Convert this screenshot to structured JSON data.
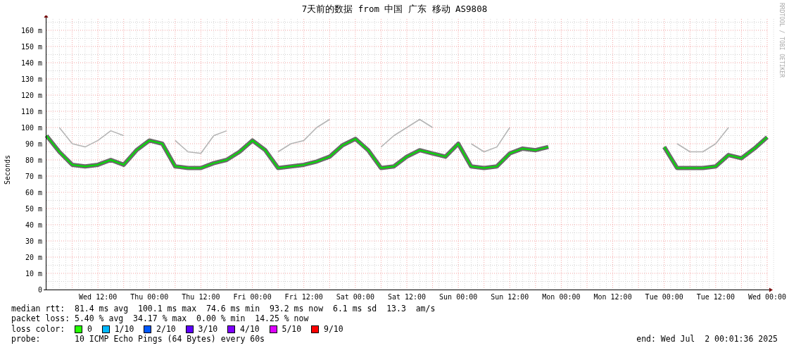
{
  "title": "7天前的数据 from 中国 广东 移动 AS9808",
  "credit": "RRDTOOL / TOBI OETIKER",
  "chart": {
    "chart_data": {
      "type": "line",
      "grid": true,
      "ylabel": "Seconds",
      "ylim": [
        0,
        167
      ],
      "categories": [
        null,
        null,
        null,
        null,
        "Wed 12:00",
        null,
        null,
        null,
        "Thu 00:00",
        null,
        null,
        null,
        "Thu 12:00",
        null,
        null,
        null,
        "Fri 00:00",
        null,
        null,
        null,
        "Fri 12:00",
        null,
        null,
        null,
        "Sat 00:00",
        null,
        null,
        null,
        "Sat 12:00",
        null,
        null,
        null,
        "Sun 00:00",
        null,
        null,
        null,
        "Sun 12:00",
        null,
        null,
        null,
        "Mon 00:00",
        null,
        null,
        null,
        "Mon 12:00",
        null,
        null,
        null,
        "Tue 00:00",
        null,
        null,
        null,
        "Tue 12:00",
        null,
        null,
        null,
        "Wed 00:00"
      ],
      "yticks": [
        {
          "value": 0,
          "label": "0"
        },
        {
          "value": 10,
          "label": "10 m"
        },
        {
          "value": 20,
          "label": "20 m"
        },
        {
          "value": 30,
          "label": "30 m"
        },
        {
          "value": 40,
          "label": "40 m"
        },
        {
          "value": 50,
          "label": "50 m"
        },
        {
          "value": 60,
          "label": "60 m"
        },
        {
          "value": 70,
          "label": "70 m"
        },
        {
          "value": 80,
          "label": "80 m"
        },
        {
          "value": 90,
          "label": "90 m"
        },
        {
          "value": 100,
          "label": "100 m"
        },
        {
          "value": 110,
          "label": "110 m"
        },
        {
          "value": 120,
          "label": "120 m"
        },
        {
          "value": 130,
          "label": "130 m"
        },
        {
          "value": 140,
          "label": "140 m"
        },
        {
          "value": 150,
          "label": "150 m"
        },
        {
          "value": 160,
          "label": "160 m"
        }
      ],
      "series": [
        {
          "color": "#b4b4b4",
          "values": [
            null,
            100,
            90,
            88,
            92,
            98,
            95,
            null,
            null,
            null,
            92,
            85,
            84,
            95,
            98,
            null,
            null,
            null,
            85,
            90,
            92,
            100,
            105,
            null,
            null,
            null,
            88,
            95,
            100,
            105,
            100,
            null,
            null,
            90,
            85,
            88,
            100,
            null,
            null,
            null,
            null,
            null,
            null,
            null,
            null,
            null,
            null,
            null,
            null,
            90,
            85,
            85,
            90,
            100,
            null,
            null,
            null
          ]
        },
        {
          "color": "#00e000",
          "values": [
            95,
            85,
            77,
            76,
            77,
            80,
            77,
            86,
            92,
            90,
            76,
            75,
            75,
            78,
            80,
            85,
            92,
            86,
            75,
            76,
            77,
            79,
            82,
            89,
            93,
            86,
            75,
            76,
            82,
            86,
            84,
            82,
            90,
            76,
            75,
            76,
            84,
            87,
            86,
            88,
            null,
            null,
            null,
            null,
            null,
            null,
            null,
            null,
            88,
            75,
            75,
            75,
            76,
            83,
            81,
            87,
            94
          ]
        }
      ]
    }
  },
  "stats": [
    {
      "label": "median rtt:",
      "values": [
        "81.4 ms avg",
        "100.1 ms max",
        "74.6 ms min",
        "93.2 ms now",
        "6.1 ms sd",
        "13.3",
        "am/s"
      ]
    },
    {
      "label": "packet loss:",
      "values": [
        "5.40 % avg",
        "34.17 % max",
        "0.00 % min",
        "14.25 % now"
      ]
    }
  ],
  "loss_color": {
    "label": "loss color:",
    "items": [
      {
        "label": "0",
        "color": "#26ff00"
      },
      {
        "label": "1/10",
        "color": "#00b8ff"
      },
      {
        "label": "2/10",
        "color": "#0059ff"
      },
      {
        "label": "3/10",
        "color": "#5e00ff"
      },
      {
        "label": "4/10",
        "color": "#7e00ff"
      },
      {
        "label": "5/10",
        "color": "#dd00ff"
      },
      {
        "label": "9/10",
        "color": "#ff0000"
      }
    ]
  },
  "probe": {
    "label": "probe:",
    "value": "10 ICMP Echo Pings (64 Bytes) every 60s"
  },
  "end": "end: Wed Jul  2 00:01:36 2025"
}
